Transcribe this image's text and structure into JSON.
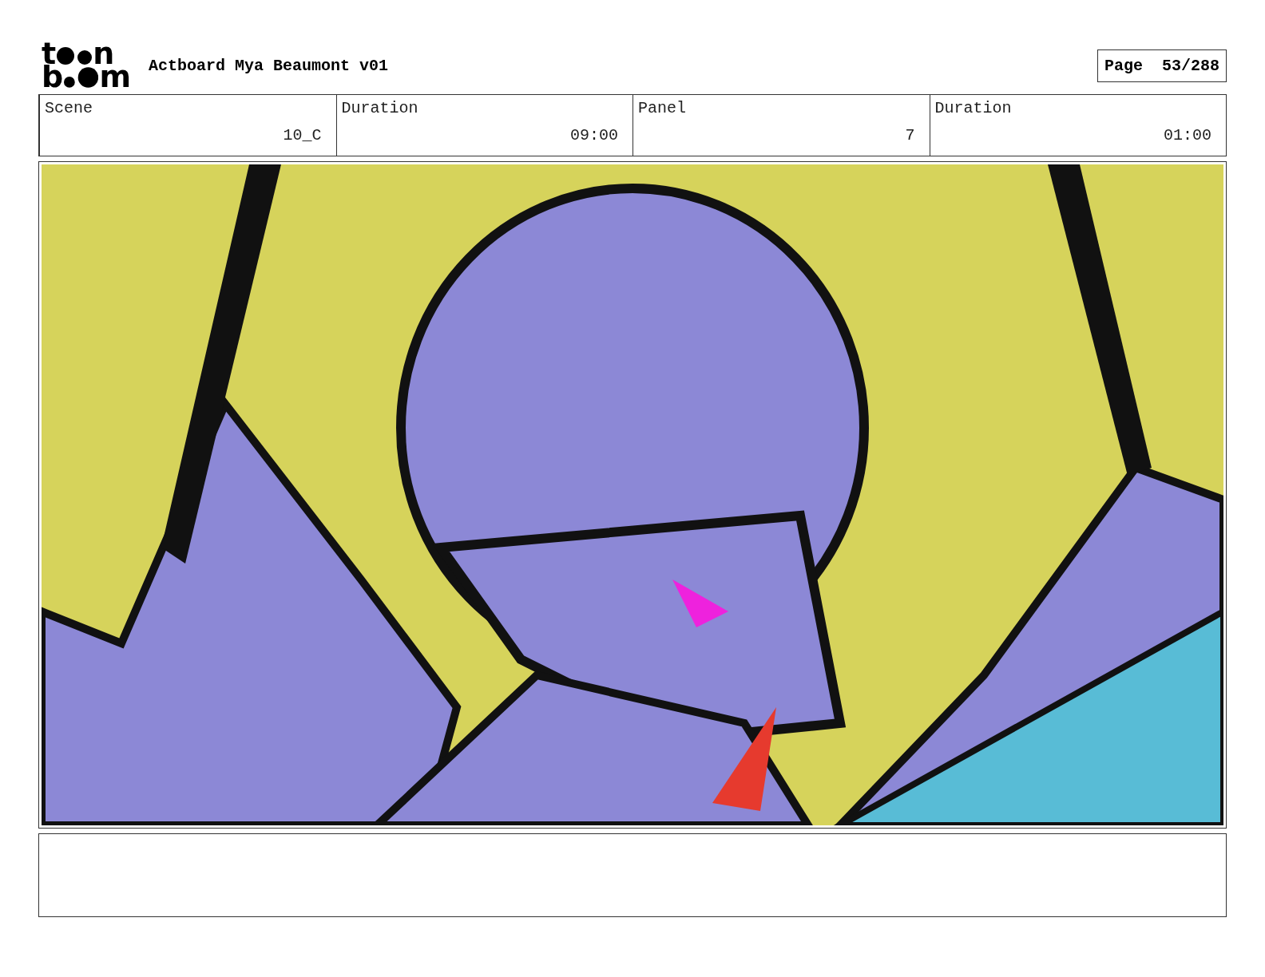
{
  "logo": {
    "rows": [
      {
        "start": "t",
        "end": "n"
      },
      {
        "start": "b",
        "end": "m"
      }
    ]
  },
  "title": "Actboard Mya Beaumont v01",
  "page": {
    "label": "Page",
    "value": "53/288"
  },
  "fields": [
    {
      "label": "Scene",
      "value": "10_C"
    },
    {
      "label": "Duration",
      "value": "09:00"
    },
    {
      "label": "Panel",
      "value": "7"
    },
    {
      "label": "Duration",
      "value": "01:00"
    }
  ]
}
